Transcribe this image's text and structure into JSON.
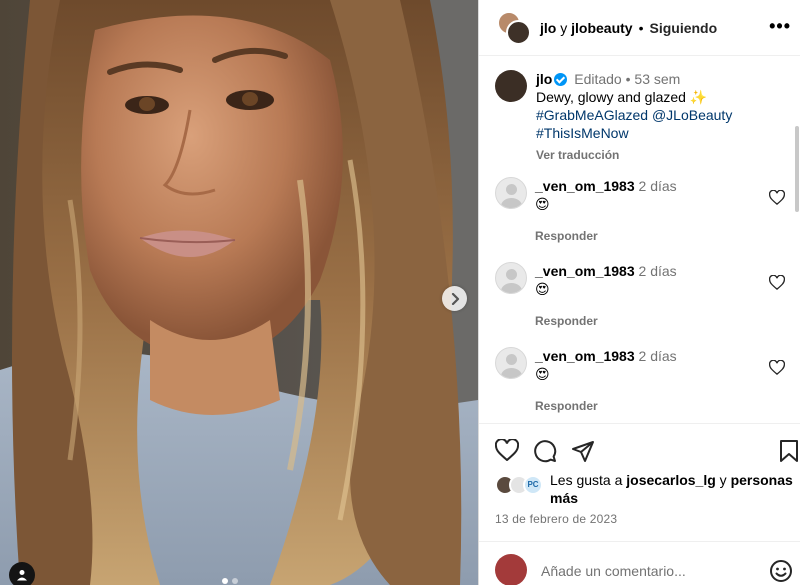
{
  "post": {
    "photo_alt": "Selfie",
    "next_icon": "chevron-right-icon",
    "tag_icon": "user-tag-icon",
    "carousel_count": 2
  },
  "header": {
    "author1": "jlo",
    "connector": "y",
    "author2": "jlobeauty",
    "separator": "•",
    "following": "Siguiendo",
    "more": "•••"
  },
  "caption": {
    "user": "jlo",
    "edited": "Editado",
    "dot": "•",
    "age": "53 sem",
    "text": "Dewy, glowy and glazed ✨",
    "tag1": "#GrabMeAGlazed",
    "mention": "@JLoBeauty",
    "tag2": "#ThisIsMeNow",
    "translate": "Ver traducción"
  },
  "comments": [
    {
      "user": "_ven_om_1983",
      "time": "2 días",
      "text": "😍",
      "reply": "Responder"
    },
    {
      "user": "_ven_om_1983",
      "time": "2 días",
      "text": "😍",
      "reply": "Responder"
    },
    {
      "user": "_ven_om_1983",
      "time": "2 días",
      "text": "😍",
      "reply": "Responder"
    }
  ],
  "likes": {
    "prefix": "Les gusta a",
    "user": "josecarlos_lg",
    "connector": "y",
    "suffix": "personas más",
    "badge": "PC"
  },
  "date": "13 de febrero de 2023",
  "add_comment": {
    "placeholder": "Añade un comentario..."
  },
  "colors": {
    "link": "#00376b",
    "verified": "#0095f6",
    "muted": "#737373"
  }
}
